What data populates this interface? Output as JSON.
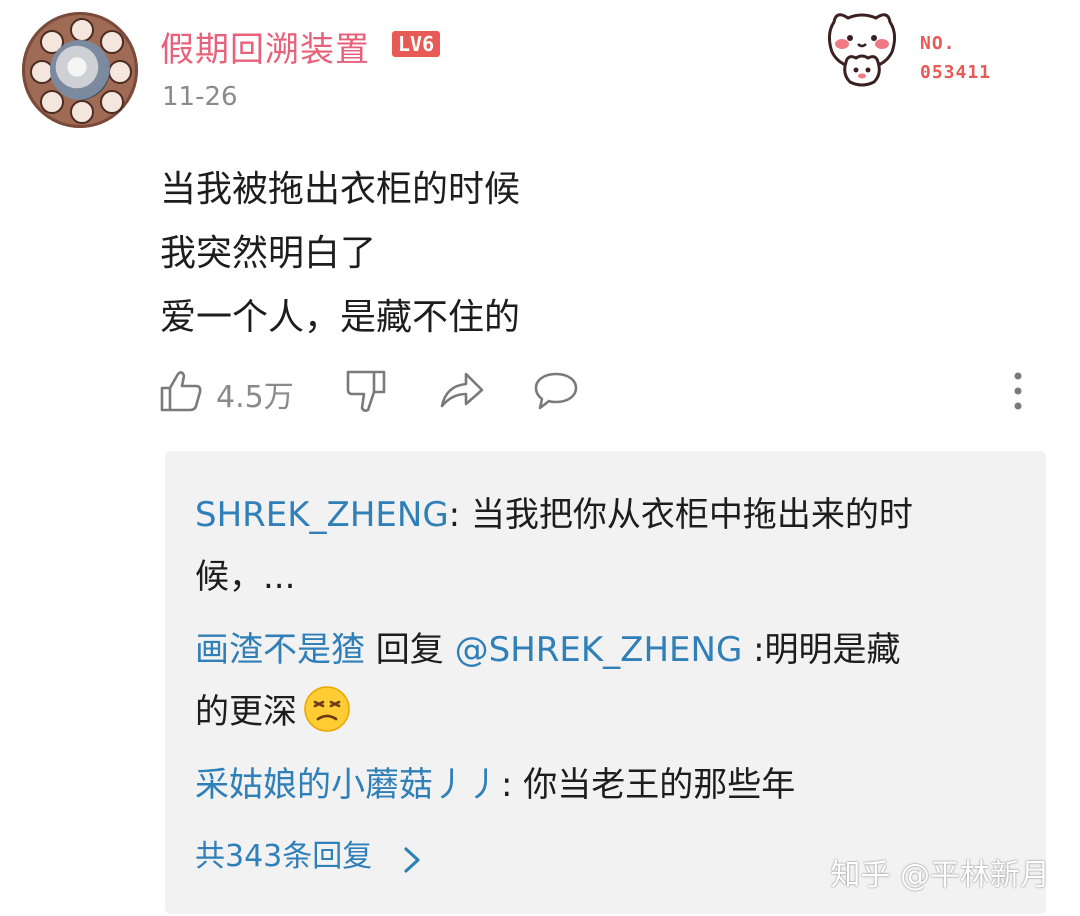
{
  "post": {
    "username": "假期回溯装置",
    "level": "LV6",
    "date": "11-26",
    "content": [
      "当我被拖出衣柜的时候",
      "我突然明白了",
      "爱一个人，是藏不住的"
    ],
    "like_count": "4.5万"
  },
  "fan_badge": {
    "no_label": "NO.",
    "number": "053411"
  },
  "replies": [
    {
      "author": "SHREK_ZHENG",
      "separator": ": ",
      "text_line1": "当我把你从衣柜中拖出来的时",
      "text_line2": "候，..."
    },
    {
      "author": "画渣不是猹",
      "reply_word": " 回复 ",
      "target": "@SHREK_ZHENG",
      "text_line1": " :明明是藏",
      "text_line2": "的更深"
    },
    {
      "author": "采姑娘的小蘑菇丿丿",
      "separator": ": ",
      "text_line1": "你当老王的那些年"
    }
  ],
  "more_replies": "共343条回复",
  "watermark": "知乎 @平林新月",
  "colors": {
    "username": "#e8617a",
    "badge": "#e85a55",
    "link_blue": "#2f7fb8",
    "gray": "#8a8a8a"
  }
}
